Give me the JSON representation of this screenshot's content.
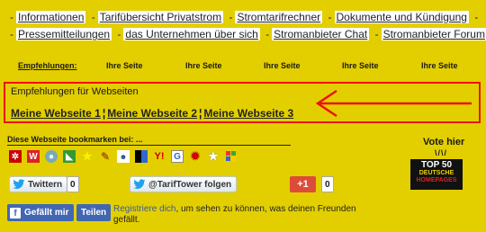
{
  "nav": {
    "row1": [
      "Informationen",
      "Tarifübersicht Privatstrom",
      "Stromtarifrechner",
      "Dokumente und Kündigung"
    ],
    "row2": [
      "Pressemitteilungen",
      "das Unternehmen über sich",
      "Stromanbieter Chat",
      "Stromanbieter Forum"
    ],
    "separator": "-"
  },
  "recommendations_row": {
    "label": "Empfehlungen:",
    "slots": [
      "Ihre Seite",
      "Ihre Seite",
      "Ihre Seite",
      "Ihre Seite",
      "Ihre Seite",
      "Ihre Seite"
    ]
  },
  "recommendation_box": {
    "title": "Empfehlungen für Webseiten",
    "links": [
      "Meine Webseite 1",
      "Meine Webseite 2",
      "Meine Webseite 3"
    ],
    "divider": "¦",
    "border_color": "#ee1111"
  },
  "bookmarks": {
    "label": "Diese Webseite bookmarken bei: ...",
    "icons": [
      "mister-wong-icon",
      "webnews-icon",
      "oneview-icon",
      "linkarena-icon",
      "favorites-icon",
      "yigg-icon",
      "folkd-icon",
      "delicious-icon",
      "yahoo-icon",
      "google-icon",
      "technorati-icon",
      "star-icon",
      "windows-live-icon"
    ]
  },
  "vote": {
    "label": "Vote hier",
    "chevrons": "\\/\\/",
    "badge_line1": "TOP 50",
    "badge_line2": "DEUTSCHE",
    "badge_line3": "HOMEPAGES"
  },
  "social": {
    "twitter_label": "Twittern",
    "twitter_count": "0",
    "follow_label": "@TarifTower folgen",
    "gplus_label": "+1",
    "gplus_count": "0",
    "fb_like_label": "Gefällt mir",
    "fb_share_label": "Teilen",
    "fb_register": "Registriere dich",
    "fb_text": ", um sehen zu können, was deinen Freunden gefällt."
  },
  "colors": {
    "background": "#e3cf00",
    "accent_red": "#ee1111",
    "facebook": "#4267b2",
    "gplus": "#dd4b39"
  }
}
